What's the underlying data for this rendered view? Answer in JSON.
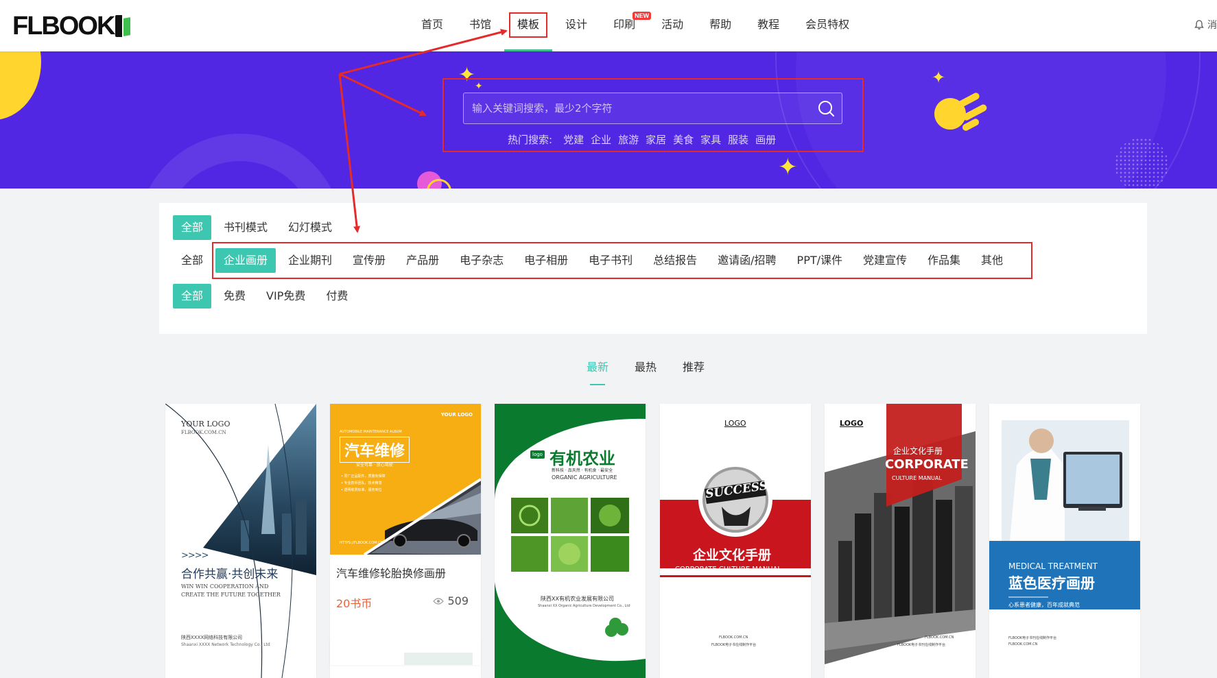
{
  "header": {
    "logo": "FLBOOK",
    "nav": [
      {
        "label": "首页",
        "active": false,
        "new": false
      },
      {
        "label": "书馆",
        "active": false,
        "new": false
      },
      {
        "label": "模板",
        "active": true,
        "new": false
      },
      {
        "label": "设计",
        "active": false,
        "new": false
      },
      {
        "label": "印刷",
        "active": false,
        "new": true
      },
      {
        "label": "活动",
        "active": false,
        "new": false
      },
      {
        "label": "帮助",
        "active": false,
        "new": false
      },
      {
        "label": "教程",
        "active": false,
        "new": false
      },
      {
        "label": "会员特权",
        "active": false,
        "new": false
      }
    ],
    "new_badge": "NEW",
    "right_text": "消"
  },
  "search": {
    "placeholder": "输入关键词搜索，最少2个字符",
    "hot_label": "热门搜索:",
    "hot": [
      "党建",
      "企业",
      "旅游",
      "家居",
      "美食",
      "家具",
      "服装",
      "画册"
    ]
  },
  "filters": {
    "mode": {
      "items": [
        "全部",
        "书刊模式",
        "幻灯模式"
      ],
      "selected": 0
    },
    "category": {
      "items": [
        "全部",
        "企业画册",
        "企业期刊",
        "宣传册",
        "产品册",
        "电子杂志",
        "电子相册",
        "电子书刊",
        "总结报告",
        "邀请函/招聘",
        "PPT/课件",
        "党建宣传",
        "作品集",
        "其他"
      ],
      "selected": 1
    },
    "price": {
      "items": [
        "全部",
        "免费",
        "VIP免费",
        "付费"
      ],
      "selected": 0
    }
  },
  "sort_tabs": {
    "items": [
      "最新",
      "最热",
      "推荐"
    ],
    "selected": 0
  },
  "cards": [
    {
      "logo": "YOUR LOGO",
      "site": "FLBOOK.COM.CN",
      "chev": ">>>>",
      "title_cn": "合作共赢·共创未来",
      "sub1": "WIN WIN COOPERATION AND",
      "sub2": "CREATE THE FUTURE TOGETHER",
      "footer1": "陕西XXXX网络科技有限公司",
      "footer2": "Shaanxi XXXX Network Technology Co., Ltd"
    },
    {
      "logo": "YOUR LOGO",
      "album": "AUTOMOBILE MAINTENANCE ALBUM",
      "title": "汽车维修",
      "tagline": "安全可靠 · 放心驾驶",
      "bullets": [
        "• 原厂正品配件，质量有保障",
        "• 专业技师团队，技术精湛",
        "• 透明收费标准，服务到位"
      ],
      "url": "HTTPS://FLBOOK.COM.CN",
      "info_title": "汽车维修轮胎换修画册",
      "price": "20书币",
      "views": "509"
    },
    {
      "logo_tag": "logo",
      "title": "有机农业",
      "slogan": "新科技 · 品天然 · 有机食 · 最安全",
      "en": "ORGANIC AGRICULTURE",
      "company": "陕西XX有机农业发展有限公司",
      "company_en": "Shaanxi XX Organic Agriculture Development Co., Ltd"
    },
    {
      "logo": "LOGO",
      "badge": "SUCCESS",
      "title": "企业文化手册",
      "en": "CORPORATE CULTURE MANUAL",
      "site": "FLBOOK.COM.CN",
      "footer": "FLBOOK电子书在线制作平台"
    },
    {
      "logo": "LOGO",
      "cn": "企业文化手册",
      "en_big": "CORPORATE",
      "en_small": "CULTURE MANUAL",
      "site": "FLBOOK.COM.CN",
      "footer": "FLBOOK电子书刊在线制作平台"
    },
    {
      "en": "MEDICAL TREATMENT",
      "title": "蓝色医疗画册",
      "slogan": "心系患者健康，百年成就典范",
      "footer1": "FLBOOK电子书刊在线制作平台",
      "footer2": "FLBOOK.COM.CN"
    }
  ],
  "colors": {
    "accent": "#3ec7b0",
    "banner": "#5227e4",
    "annotation": "#e42b2b"
  }
}
